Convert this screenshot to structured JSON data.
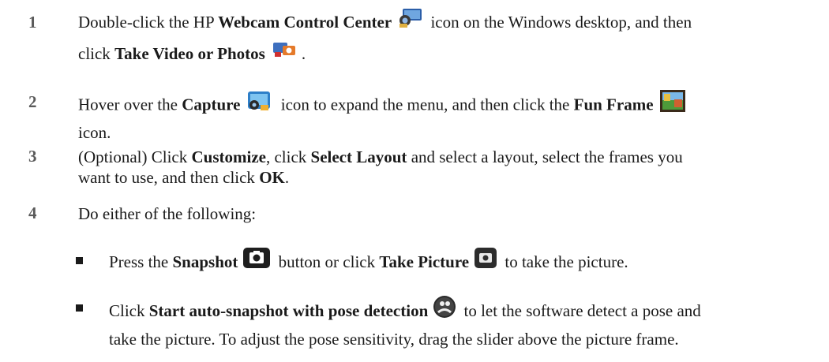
{
  "steps": [
    {
      "num": "1",
      "a": "Double-click the HP ",
      "b1": "Webcam Control Center",
      "c": " icon on the Windows desktop, and then",
      "d": "click ",
      "b2": "Take Video or Photos",
      "e": "."
    },
    {
      "num": "2",
      "a": "Hover over the ",
      "b1": "Capture",
      "c": " icon to expand the menu, and then click the ",
      "b2": "Fun Frame",
      "d": "icon."
    },
    {
      "num": "3",
      "a": "(Optional) Click ",
      "b1": "Customize",
      "c": ", click ",
      "b2": "Select Layout",
      "d": " and select a layout, select the frames you",
      "e": "want to use, and then click ",
      "b3": "OK",
      "f": "."
    },
    {
      "num": "4",
      "a": "Do either of the following:"
    }
  ],
  "bullets": [
    {
      "a": "Press the ",
      "b1": "Snapshot",
      "c": " button or click ",
      "b2": "Take Picture",
      "d": " to take the picture."
    },
    {
      "a": "Click ",
      "b1": "Start auto-snapshot with pose detection",
      "c": " to let the software detect a pose and",
      "d": "take the picture. To adjust the pose sensitivity, drag the slider above the picture frame."
    }
  ],
  "icons": {
    "webcam_control_center": "webcam-control-center-icon",
    "take_video_or_photos": "take-video-or-photos-icon",
    "capture": "capture-icon",
    "fun_frame": "fun-frame-icon",
    "snapshot": "snapshot-camera-icon",
    "take_picture": "take-picture-icon",
    "pose_detection": "pose-detection-icon"
  }
}
